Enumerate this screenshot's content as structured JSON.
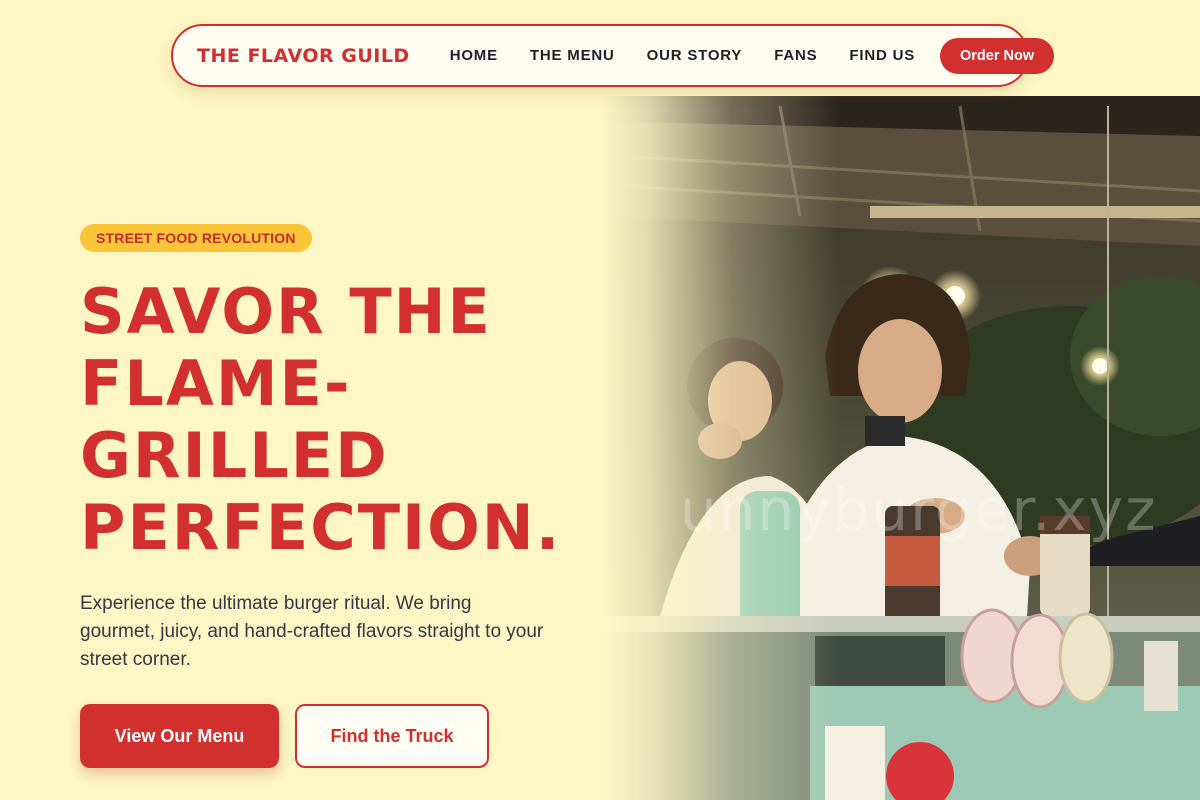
{
  "nav": {
    "brand": "THE FLAVOR GUILD",
    "links": [
      "HOME",
      "THE MENU",
      "OUR STORY",
      "FANS",
      "FIND US"
    ],
    "cta": "Order Now"
  },
  "hero": {
    "badge": "STREET FOOD REVOLUTION",
    "headline_lines": [
      "SAVOR THE",
      "FLAME-",
      "GRILLED",
      "PERFECTION."
    ],
    "subtext": "Experience the ultimate burger ritual. We bring gourmet, juicy, and hand-crafted flavors straight to your street corner.",
    "primary_button": "View Our Menu",
    "secondary_button": "Find the Truck",
    "watermark": "unnyburger.xyz"
  },
  "colors": {
    "background": "#fef6c4",
    "brand_red": "#d22f2f",
    "badge_yellow": "#fbc53a",
    "body_text": "#333944"
  }
}
